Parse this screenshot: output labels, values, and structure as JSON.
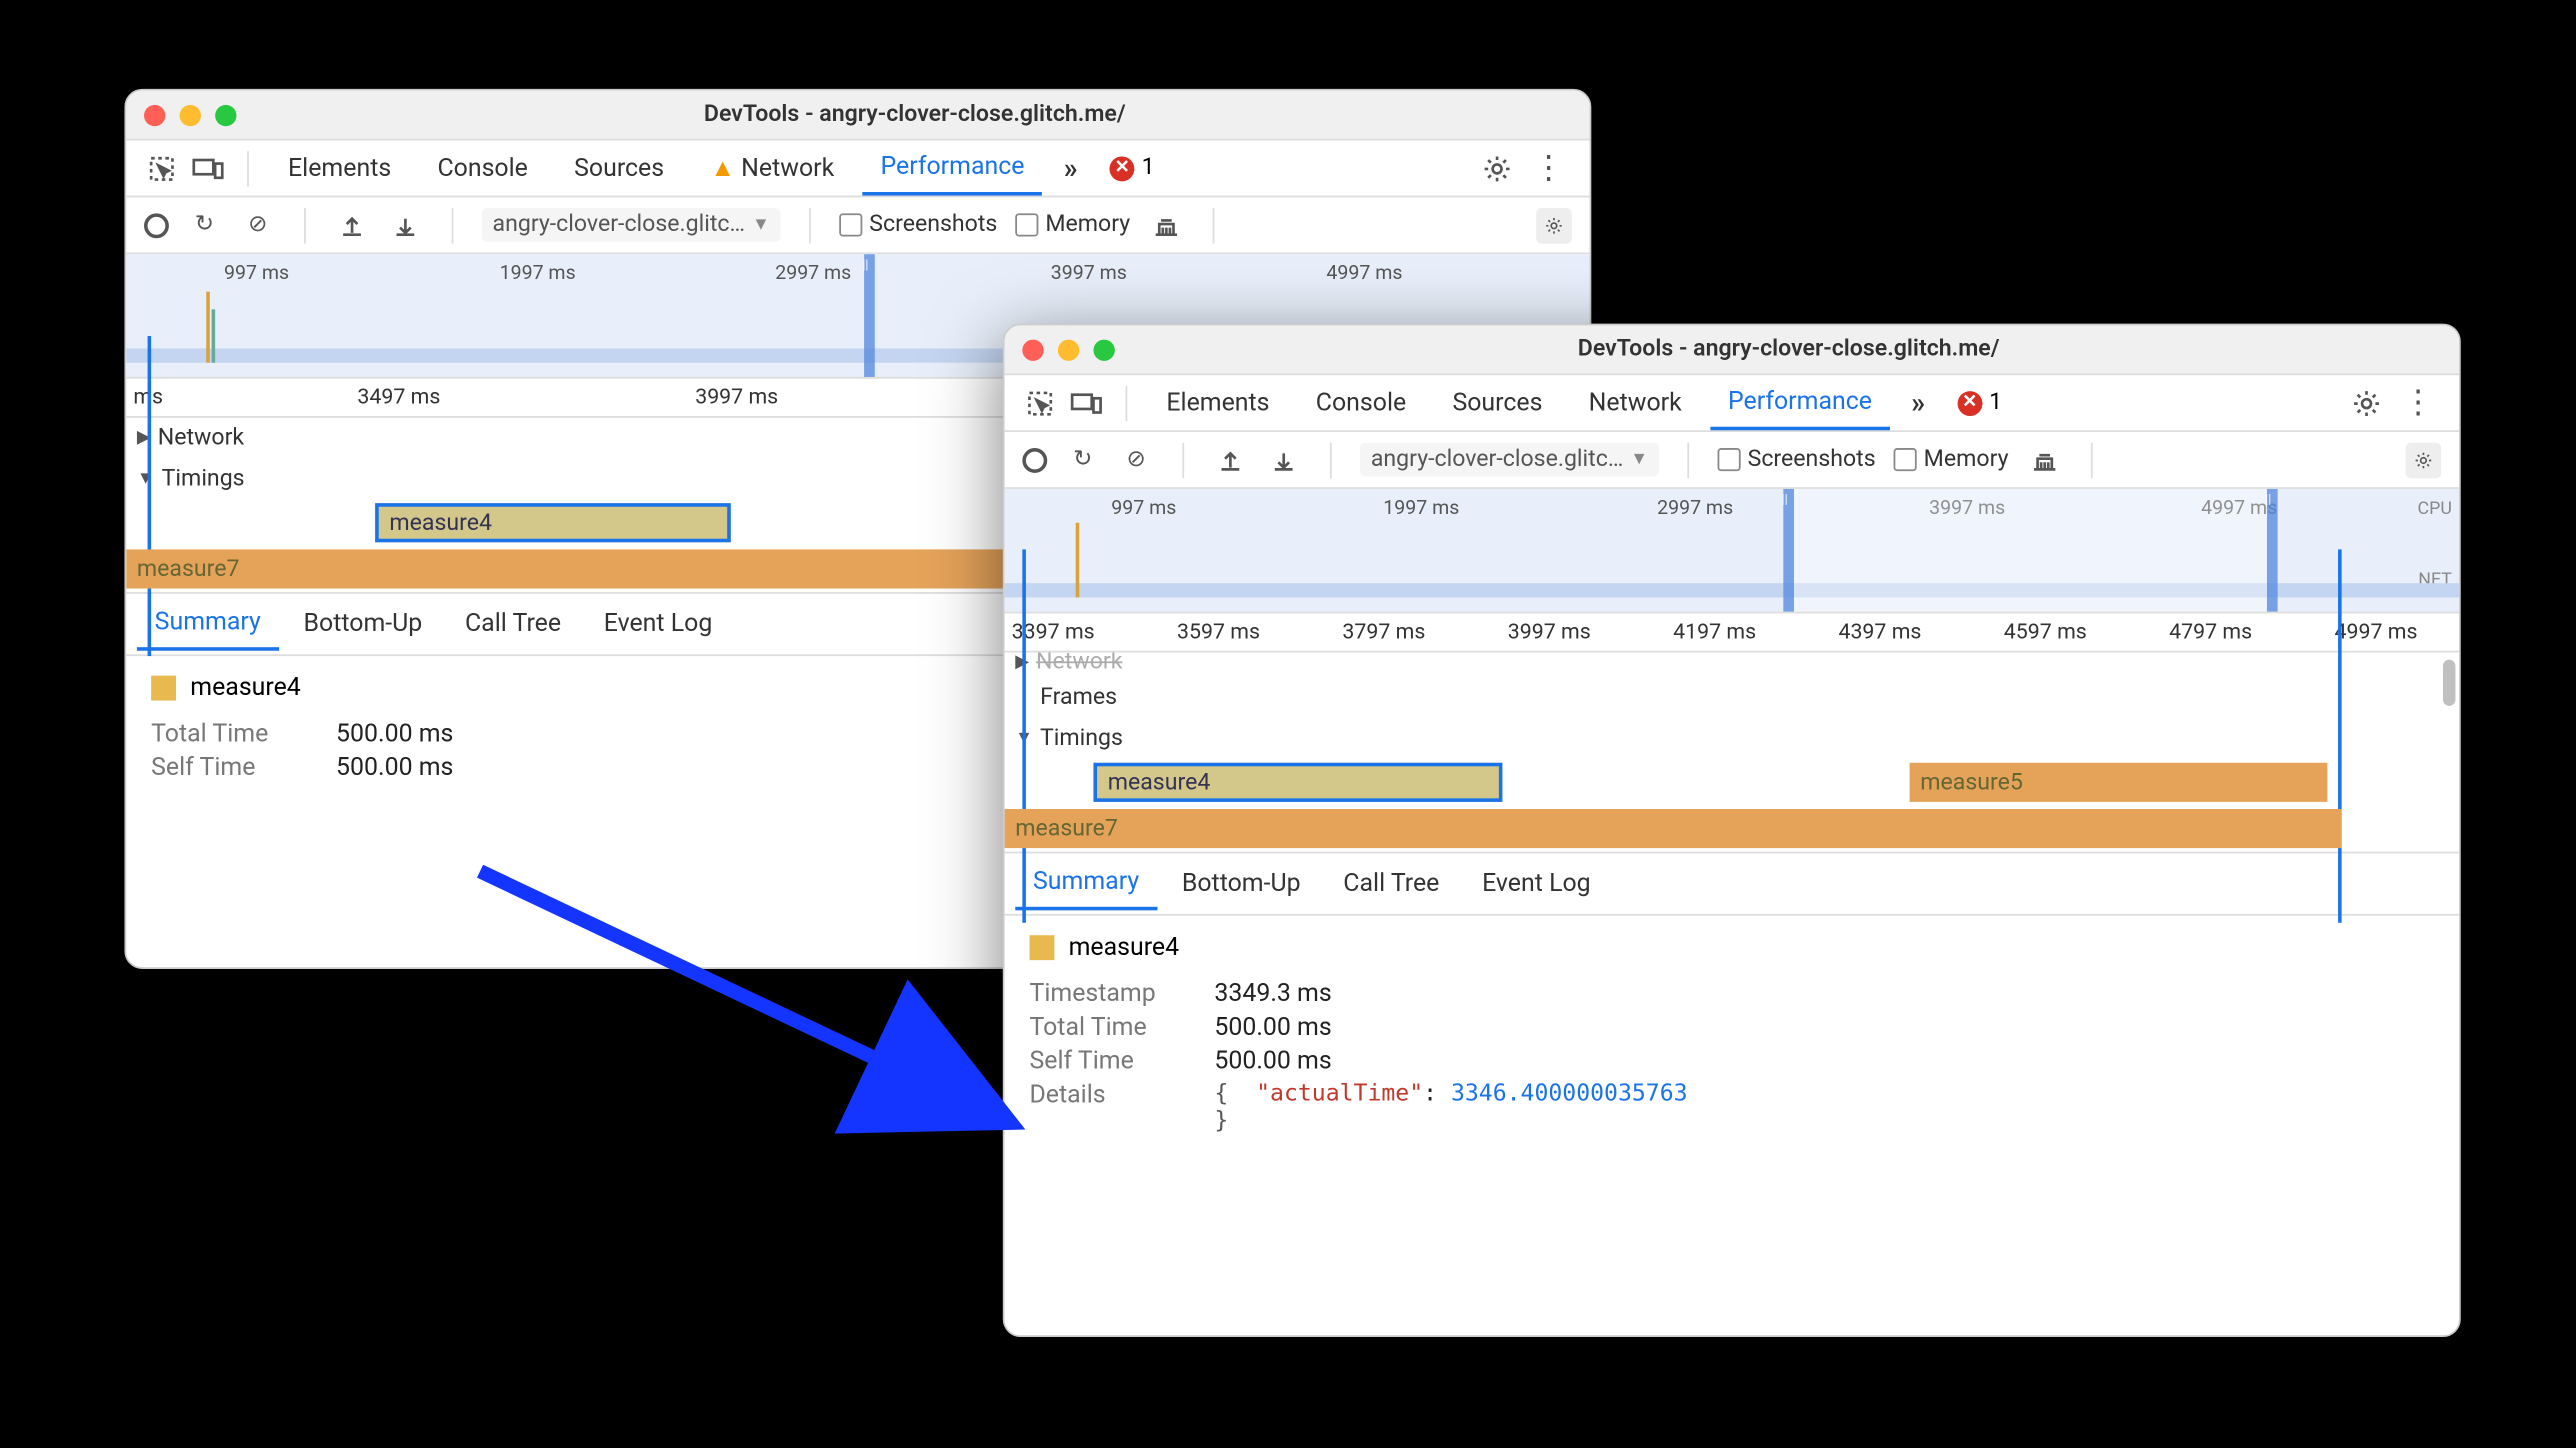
{
  "windows": {
    "w1": {
      "title": "DevTools - angry-clover-close.glitch.me/",
      "tabs": [
        "Elements",
        "Console",
        "Sources",
        "Network",
        "Performance"
      ],
      "active_tab_idx": 4,
      "network_warn": true,
      "error_count": "1",
      "url_selector": "angry-clover-close.glitc…",
      "screenshots_label": "Screenshots",
      "memory_label": "Memory",
      "overview_ticks": [
        "997 ms",
        "1997 ms",
        "2997 ms",
        "3997 ms",
        "4997 ms"
      ],
      "ruler_ms": "ms",
      "ruler_ticks": [
        "3497 ms",
        "3997 ms"
      ],
      "track_network": "Network",
      "track_timings": "Timings",
      "measure4_label": "measure4",
      "measure7_label": "measure7",
      "detail_tabs": [
        "Summary",
        "Bottom-Up",
        "Call Tree",
        "Event Log"
      ],
      "detail_active": 0,
      "selected_name": "measure4",
      "rows": [
        {
          "k": "Total Time",
          "v": "500.00 ms"
        },
        {
          "k": "Self Time",
          "v": "500.00 ms"
        }
      ]
    },
    "w2": {
      "title": "DevTools - angry-clover-close.glitch.me/",
      "tabs": [
        "Elements",
        "Console",
        "Sources",
        "Network",
        "Performance"
      ],
      "active_tab_idx": 4,
      "error_count": "1",
      "url_selector": "angry-clover-close.glitc…",
      "screenshots_label": "Screenshots",
      "memory_label": "Memory",
      "overview_ticks": [
        "997 ms",
        "1997 ms",
        "2997 ms",
        "3997 ms",
        "4997 ms"
      ],
      "overview_side": {
        "cpu": "CPU",
        "net": "NET"
      },
      "ruler_ticks": [
        "3397 ms",
        "3597 ms",
        "3797 ms",
        "3997 ms",
        "4197 ms",
        "4397 ms",
        "4597 ms",
        "4797 ms",
        "4997 ms"
      ],
      "track_network": "Network",
      "track_frames": "Frames",
      "track_timings": "Timings",
      "measure4_label": "measure4",
      "measure5_label": "measure5",
      "measure7_label": "measure7",
      "detail_tabs": [
        "Summary",
        "Bottom-Up",
        "Call Tree",
        "Event Log"
      ],
      "detail_active": 0,
      "selected_name": "measure4",
      "rows": [
        {
          "k": "Timestamp",
          "v": "3349.3 ms"
        },
        {
          "k": "Total Time",
          "v": "500.00 ms"
        },
        {
          "k": "Self Time",
          "v": "500.00 ms"
        }
      ],
      "details_label": "Details",
      "details_json_key": "\"actualTime\"",
      "details_json_val": "3346.400000035763"
    }
  }
}
